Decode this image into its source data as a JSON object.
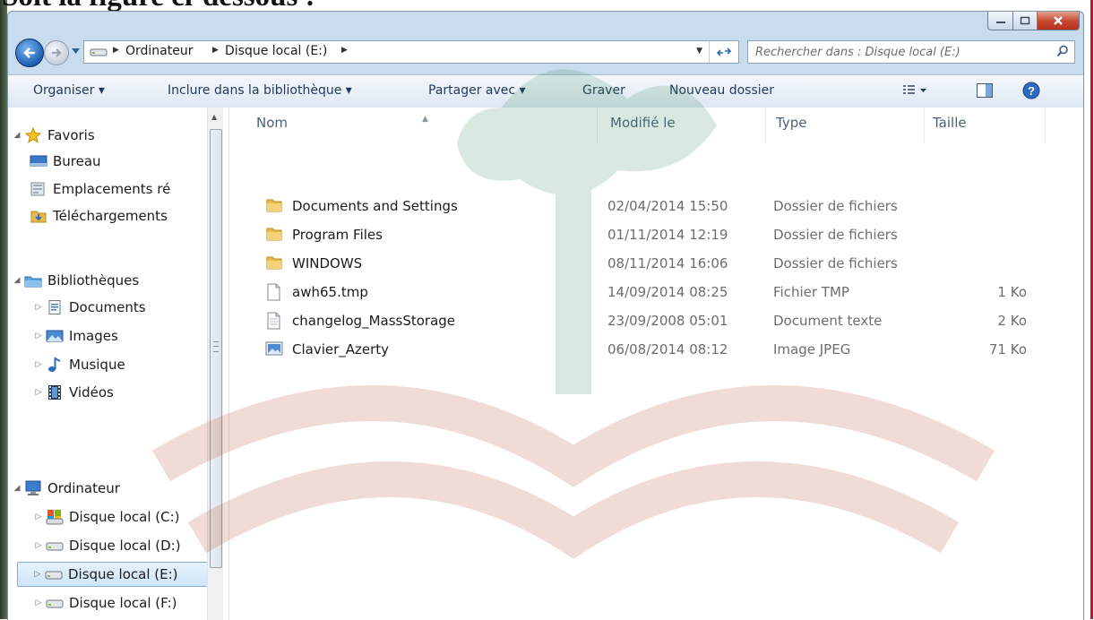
{
  "page_heading": "Soit la figure ci-dessous :",
  "address": {
    "crumbs": [
      "Ordinateur",
      "Disque local (E:)"
    ],
    "search_placeholder": "Rechercher dans : Disque local (E:)"
  },
  "toolbar": {
    "organize": "Organiser ▾",
    "include": "Inclure dans la bibliothèque ▾",
    "share": "Partager avec ▾",
    "burn": "Graver",
    "new_folder": "Nouveau dossier"
  },
  "nav": {
    "favorites": {
      "label": "Favoris",
      "items": [
        "Bureau",
        "Emplacements ré",
        "Téléchargements"
      ]
    },
    "libraries": {
      "label": "Bibliothèques",
      "items": [
        "Documents",
        "Images",
        "Musique",
        "Vidéos"
      ]
    },
    "computer": {
      "label": "Ordinateur",
      "items": [
        "Disque local (C:)",
        "Disque local (D:)",
        "Disque local (E:)",
        "Disque local (F:)"
      ]
    },
    "selected": "Disque local (E:)"
  },
  "columns": {
    "name": "Nom",
    "modified": "Modifié le",
    "type": "Type",
    "size": "Taille"
  },
  "files": [
    {
      "name": "Documents and Settings",
      "modified": "02/04/2014 15:50",
      "type": "Dossier de fichiers",
      "size": "",
      "icon": "folder-icon"
    },
    {
      "name": "Program Files",
      "modified": "01/11/2014 12:19",
      "type": "Dossier de fichiers",
      "size": "",
      "icon": "folder-icon"
    },
    {
      "name": "WINDOWS",
      "modified": "08/11/2014 16:06",
      "type": "Dossier de fichiers",
      "size": "",
      "icon": "folder-icon"
    },
    {
      "name": "awh65.tmp",
      "modified": "14/09/2014 08:25",
      "type": "Fichier TMP",
      "size": "1 Ko",
      "icon": "file-icon"
    },
    {
      "name": "changelog_MassStorage",
      "modified": "23/09/2008 05:01",
      "type": "Document texte",
      "size": "2 Ko",
      "icon": "text-file-icon"
    },
    {
      "name": "Clavier_Azerty",
      "modified": "06/08/2014 08:12",
      "type": "Image JPEG",
      "size": "71 Ko",
      "icon": "image-file-icon"
    }
  ],
  "colors": {
    "accent": "#1e395b",
    "selection": "#cfe5f9",
    "folder": "#e8b84a"
  }
}
